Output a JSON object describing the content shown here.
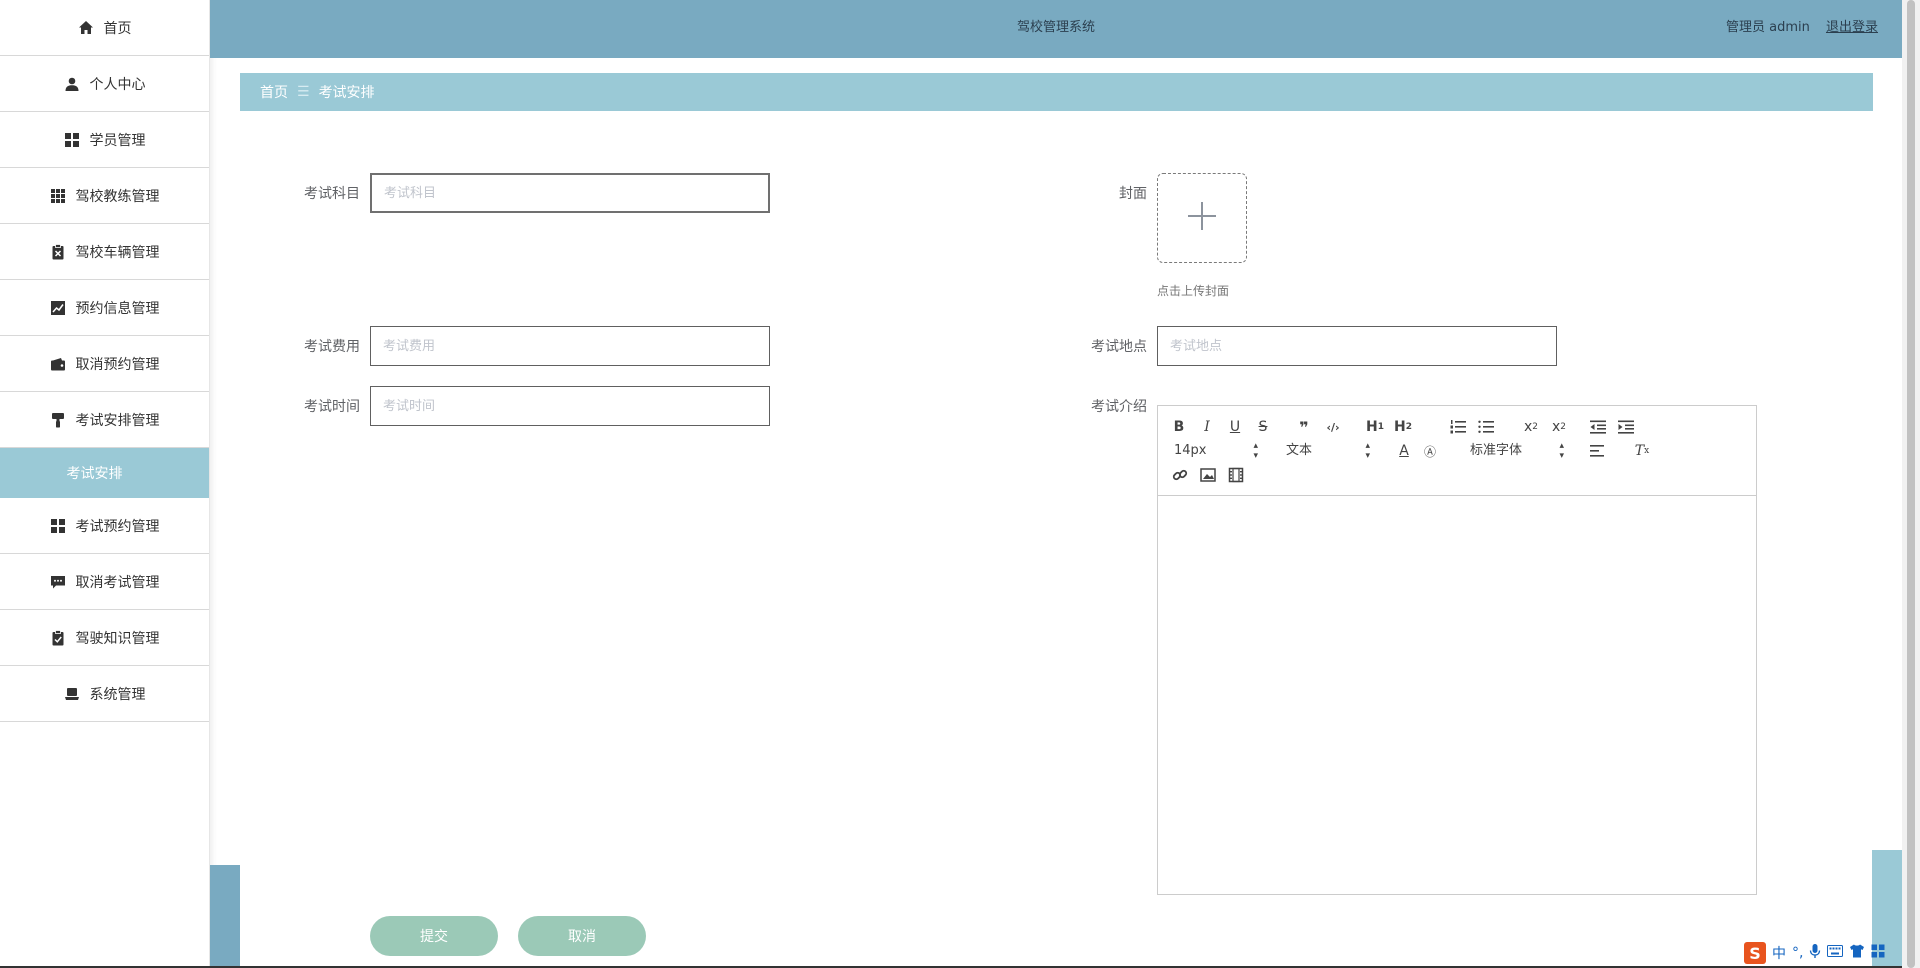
{
  "header": {
    "title": "驾校管理系统",
    "user_label": "管理员 admin",
    "logout_label": "退出登录"
  },
  "sidebar": {
    "items": [
      {
        "label": "首页",
        "icon": "home-icon"
      },
      {
        "label": "个人中心",
        "icon": "user-icon"
      },
      {
        "label": "学员管理",
        "icon": "grid-icon"
      },
      {
        "label": "驾校教练管理",
        "icon": "apps-icon"
      },
      {
        "label": "驾校车辆管理",
        "icon": "clipboard-x-icon"
      },
      {
        "label": "预约信息管理",
        "icon": "chart-icon"
      },
      {
        "label": "取消预约管理",
        "icon": "wallet-icon"
      },
      {
        "label": "考试安排管理",
        "icon": "paint-roller-icon"
      },
      {
        "label": "考试安排",
        "sub": true
      },
      {
        "label": "考试预约管理",
        "icon": "grid-icon"
      },
      {
        "label": "取消考试管理",
        "icon": "message-icon"
      },
      {
        "label": "驾驶知识管理",
        "icon": "clipboard-check-icon"
      },
      {
        "label": "系统管理",
        "icon": "laptop-icon"
      }
    ]
  },
  "breadcrumb": {
    "home": "首页",
    "separator": "☰",
    "current": "考试安排"
  },
  "form": {
    "subject": {
      "label": "考试科目",
      "placeholder": "考试科目",
      "value": ""
    },
    "cover": {
      "label": "封面",
      "tip": "点击上传封面"
    },
    "fee": {
      "label": "考试费用",
      "placeholder": "考试费用",
      "value": ""
    },
    "location": {
      "label": "考试地点",
      "placeholder": "考试地点",
      "value": ""
    },
    "time": {
      "label": "考试时间",
      "placeholder": "考试时间",
      "value": ""
    },
    "intro": {
      "label": "考试介绍"
    }
  },
  "editor": {
    "font_size": "14px",
    "header_picker": "文本",
    "font_family": "标准字体"
  },
  "buttons": {
    "submit": "提交",
    "cancel": "取消"
  },
  "ime": {
    "logo": "S",
    "lang": "中",
    "punct": "°,"
  },
  "colors": {
    "header": "#79aac1",
    "breadcrumb": "#9ac9d6",
    "button": "#9bc9b7"
  }
}
